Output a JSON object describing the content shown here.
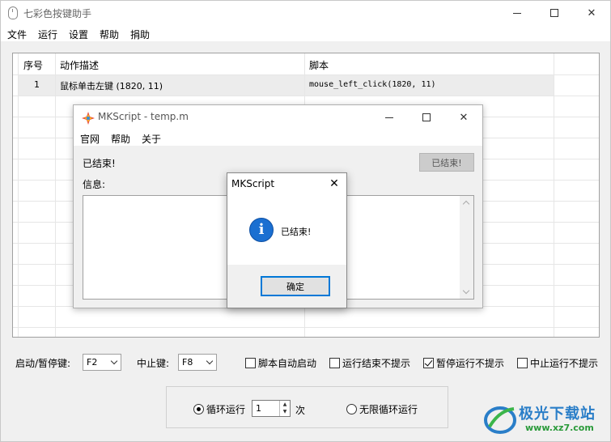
{
  "main": {
    "title": "七彩色按键助手",
    "menu": [
      "文件",
      "运行",
      "设置",
      "帮助",
      "捐助"
    ]
  },
  "grid": {
    "headers": [
      "序号",
      "动作描述",
      "脚本"
    ],
    "rows": [
      {
        "index": "1",
        "desc": "鼠标单击左键 (1820, 11)",
        "script": "mouse_left_click(1820, 11)"
      }
    ]
  },
  "controls": {
    "start_pause_label": "启动/暂停键:",
    "start_pause_key": "F2",
    "stop_label": "中止键:",
    "stop_key": "F8",
    "checkboxes": [
      {
        "label": "脚本自动启动",
        "checked": false
      },
      {
        "label": "运行结束不提示",
        "checked": false
      },
      {
        "label": "暂停运行不提示",
        "checked": true
      },
      {
        "label": "中止运行不提示",
        "checked": false
      }
    ],
    "loop_run_label": "循环运行",
    "loop_count": "1",
    "loop_unit": "次",
    "infinite_label": "无限循环运行"
  },
  "mkscript": {
    "title": "MKScript - temp.m",
    "menu": [
      "官网",
      "帮助",
      "关于"
    ],
    "status": "已结束!",
    "done_button": "已结束!",
    "info_label": "信息:"
  },
  "msgbox": {
    "title": "MKScript",
    "message": "已结束!",
    "ok": "确定"
  },
  "watermark": {
    "cn": "极光下载站",
    "en": "www.xz7.com"
  }
}
